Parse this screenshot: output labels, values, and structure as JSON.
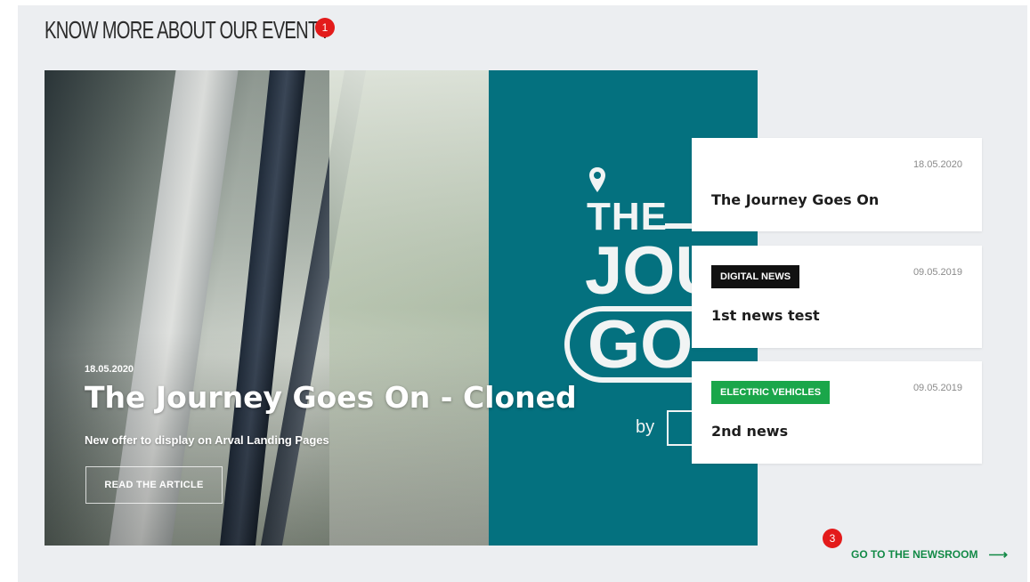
{
  "section": {
    "title": "KNOW MORE ABOUT OUR EVENT !",
    "badge_top": "1",
    "badge_bottom": "3"
  },
  "hero": {
    "date": "18.05.2020",
    "title": "The Journey Goes On - Cloned",
    "subtitle": "New offer to display on Arval Landing Pages",
    "button_label": "READ THE ARTICLE",
    "brand": {
      "the": "THE",
      "jou": "JOU",
      "go": "GO",
      "by": "by"
    }
  },
  "news": [
    {
      "date": "18.05.2020",
      "tag": "",
      "title": "The Journey Goes On"
    },
    {
      "date": "09.05.2019",
      "tag": "DIGITAL NEWS",
      "title": "1st news test"
    },
    {
      "date": "09.05.2019",
      "tag": "ELECTRIC VEHICLES",
      "title": "2nd news"
    }
  ],
  "newsroom_link": {
    "label": "GO TO THE NEWSROOM",
    "arrow": "⟶"
  },
  "colors": {
    "brand_teal": "#04717f",
    "link_green": "#138a47",
    "tag_electric": "#1aa64a",
    "tag_digital": "#111111",
    "badge_red": "#e31b1b"
  }
}
